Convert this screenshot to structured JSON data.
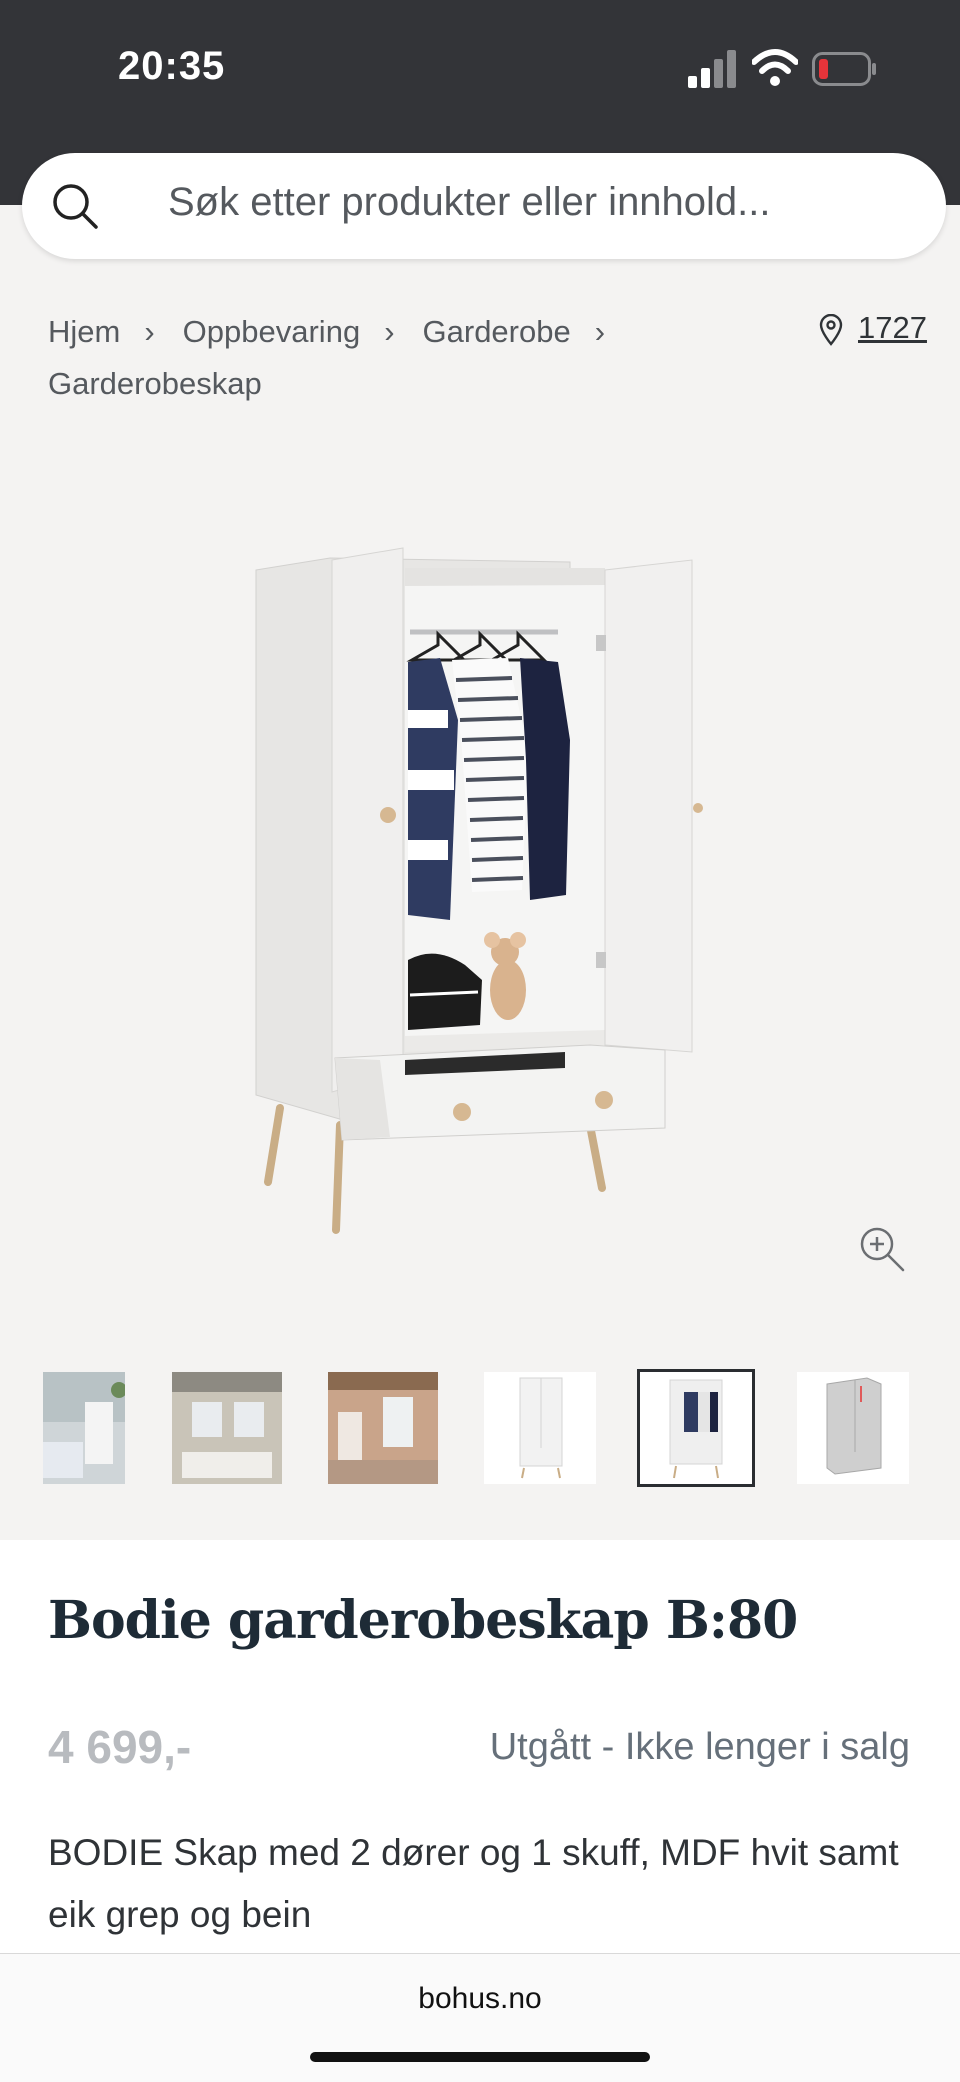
{
  "status_bar": {
    "time": "20:35"
  },
  "search": {
    "placeholder": "Søk etter produkter eller innhold..."
  },
  "breadcrumb": [
    "Hjem",
    "Oppbevaring",
    "Garderobe",
    "Garderobeskap"
  ],
  "store": {
    "number": "1727"
  },
  "thumbnails": [
    {
      "name": "thumb-room-1"
    },
    {
      "name": "thumb-room-2"
    },
    {
      "name": "thumb-room-3"
    },
    {
      "name": "thumb-closed"
    },
    {
      "name": "thumb-open",
      "selected": true
    },
    {
      "name": "thumb-dimensions"
    }
  ],
  "product": {
    "title": "Bodie garderobeskap B:80",
    "price": "4 699,-",
    "status": "Utgått - Ikke lenger i salg",
    "description": "BODIE Skap med 2 dører og 1 skuff, MDF hvit samt eik grep og bein"
  },
  "browser": {
    "url": "bohus.no"
  },
  "colors": {
    "header": "#333438",
    "background": "#f4f3f2",
    "title": "#1e2b36"
  }
}
